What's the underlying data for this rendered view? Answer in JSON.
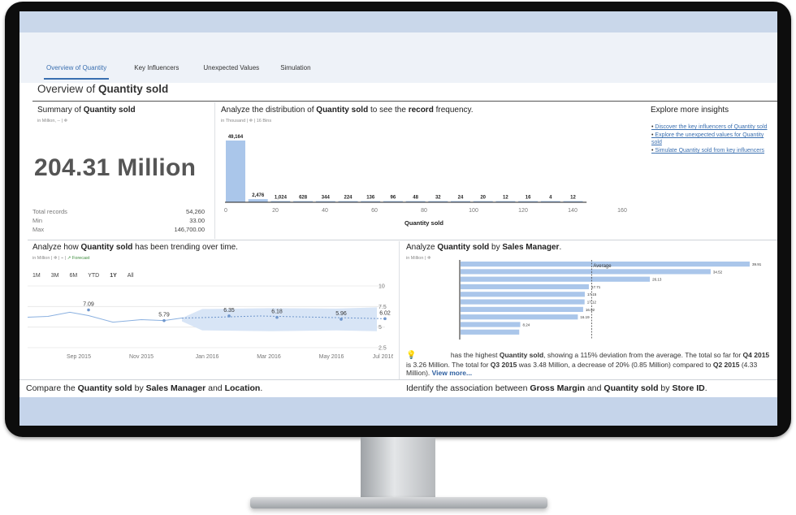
{
  "tabs": [
    {
      "label": "Overview of Quantity",
      "active": true
    },
    {
      "label": "Key Influencers",
      "active": false
    },
    {
      "label": "Unexpected Values",
      "active": false
    },
    {
      "label": "Simulation",
      "active": false
    }
  ],
  "page_title_prefix": "Overview of ",
  "page_title_bold": "Quantity sold",
  "summary": {
    "title_prefix": "Summary of ",
    "title_bold": "Quantity sold",
    "subtitle": "in Million, -- | ❄",
    "big_value": "204.31 Million",
    "stats": [
      {
        "label": "Total records",
        "value": "54,260"
      },
      {
        "label": "Min",
        "value": "33.00"
      },
      {
        "label": "Max",
        "value": "146,700.00"
      }
    ]
  },
  "distribution": {
    "title_a": "Analyze the distribution of ",
    "title_b": "Quantity sold",
    "title_c": " to see the ",
    "title_d": "record",
    "title_e": " frequency.",
    "subtitle": "in Thousand | ❄ | 16 Bins",
    "xlabel": "Quantity sold"
  },
  "explore": {
    "title": "Explore more insights",
    "links": [
      "Discover the key influencers of Quantity sold",
      "Explore the unexpected values for Quantity sold",
      "Simulate Quantity sold from key influencers"
    ]
  },
  "trend": {
    "title_a": "Analyze how ",
    "title_b": "Quantity sold",
    "title_c": " has been trending over time.",
    "subtitle": "in Million | ❄ | ⌁ | ↗ Forecast",
    "forecast_label": "Forecast",
    "ranges": [
      "1M",
      "3M",
      "6M",
      "YTD",
      "1Y",
      "All"
    ],
    "selected_range": "1Y"
  },
  "by_manager": {
    "title_a": "Analyze ",
    "title_b": "Quantity sold",
    "title_c": " by ",
    "title_d": "Sales Manager",
    "title_e": ".",
    "subtitle": "in Million | ❄",
    "average_label": "Average"
  },
  "insight": {
    "text_a": " has the highest ",
    "text_b": "Quantity sold",
    "text_c": ", showing a 115% deviation from the average. The total so far for ",
    "text_d": "Q4 2015",
    "text_e": " is 3.26 Million. The total for ",
    "text_f": "Q3 2015",
    "text_g": " was 3.48 Million, a decrease of 20% (0.85 Million) compared to ",
    "text_h": "Q2 2015",
    "text_i": " (4.33 Million). ",
    "link": "View more..."
  },
  "compare": {
    "title_a": "Compare the ",
    "title_b": "Quantity sold",
    "title_c": " by ",
    "title_d": "Sales Manager",
    "title_e": " and ",
    "title_f": "Location",
    "title_g": "."
  },
  "association": {
    "title_a": "Identify the association between ",
    "title_b": "Gross Margin",
    "title_c": " and ",
    "title_d": "Quantity sold",
    "title_e": " by ",
    "title_f": "Store ID",
    "title_g": "."
  },
  "colors": {
    "bar": "#aac6ea",
    "accent": "#3a6fb0",
    "band": "#c9d7ea"
  },
  "chart_data": [
    {
      "type": "bar",
      "bar_labels": [
        "49,164",
        "2,476",
        "1,024",
        "628",
        "344",
        "224",
        "136",
        "96",
        "48",
        "32",
        "24",
        "20",
        "12",
        "16",
        "4",
        "12"
      ],
      "values": [
        49164,
        2476,
        1024,
        628,
        344,
        224,
        136,
        96,
        48,
        32,
        24,
        20,
        12,
        16,
        4,
        12
      ],
      "xticks": [
        "0",
        "20",
        "40",
        "60",
        "80",
        "100",
        "120",
        "140",
        "160"
      ],
      "xlabel": "Quantity sold"
    },
    {
      "type": "line",
      "x": [
        "Sep 2015",
        "Nov 2015",
        "Jan 2016",
        "Mar 2016",
        "May 2016",
        "Jul 2016"
      ],
      "labeled_points": [
        {
          "label": "7.09",
          "value": 7.09
        },
        {
          "label": "5.79",
          "value": 5.79
        },
        {
          "label": "6.35",
          "value": 6.35
        },
        {
          "label": "6.18",
          "value": 6.18
        },
        {
          "label": "5.96",
          "value": 5.96
        },
        {
          "label": "6.02",
          "value": 6.02
        }
      ],
      "yticks": [
        "10",
        "7.5",
        "5",
        "2.5"
      ],
      "ylim": [
        2.5,
        10
      ]
    },
    {
      "type": "bar",
      "orientation": "horizontal",
      "bar_labels": [
        "39.91",
        "34.52",
        "26.13",
        "17.71",
        "17.15",
        "17.12",
        "16.92",
        "16.19",
        "8.24",
        ""
      ],
      "values": [
        39.91,
        34.52,
        26.13,
        17.71,
        17.15,
        17.12,
        16.92,
        16.19,
        8.24,
        8.1
      ],
      "average_label": "Average"
    }
  ]
}
